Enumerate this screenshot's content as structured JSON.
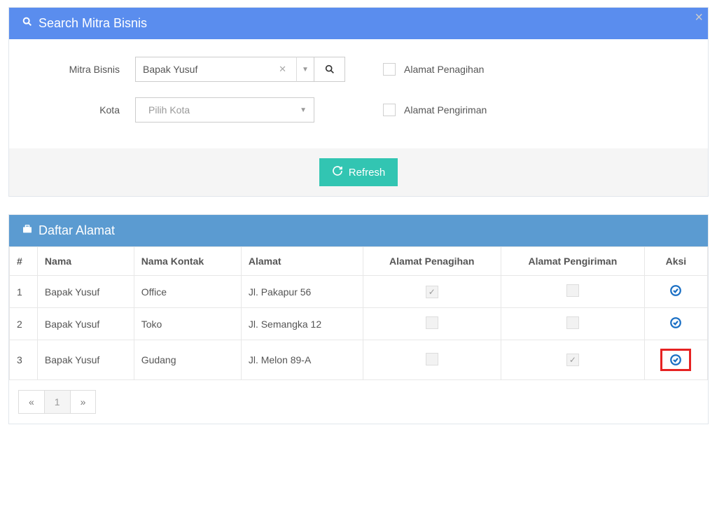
{
  "close_label": "×",
  "search_panel": {
    "title": "Search Mitra Bisnis",
    "mitra_label": "Mitra Bisnis",
    "mitra_value": "Bapak Yusuf",
    "kota_label": "Kota",
    "kota_placeholder": "Pilih Kota",
    "penagihan_label": "Alamat Penagihan",
    "pengiriman_label": "Alamat Pengiriman",
    "refresh_label": "Refresh"
  },
  "list_panel": {
    "title": "Daftar Alamat",
    "headers": {
      "num": "#",
      "nama": "Nama",
      "kontak": "Nama Kontak",
      "alamat": "Alamat",
      "penagihan": "Alamat Penagihan",
      "pengiriman": "Alamat Pengiriman",
      "aksi": "Aksi"
    },
    "rows": [
      {
        "num": "1",
        "nama": "Bapak Yusuf",
        "kontak": "Office",
        "alamat": "Jl. Pakapur 56",
        "penagihan": true,
        "pengiriman": false
      },
      {
        "num": "2",
        "nama": "Bapak Yusuf",
        "kontak": "Toko",
        "alamat": "Jl. Semangka 12",
        "penagihan": false,
        "pengiriman": false
      },
      {
        "num": "3",
        "nama": "Bapak Yusuf",
        "kontak": "Gudang",
        "alamat": "Jl. Melon 89-A",
        "penagihan": false,
        "pengiriman": true
      }
    ]
  },
  "pager": {
    "prev": "«",
    "page": "1",
    "next": "»"
  }
}
